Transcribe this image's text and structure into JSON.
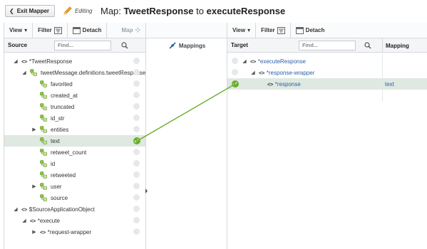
{
  "topbar": {
    "exit_label": "Exit Mapper",
    "editing_label": "Editing",
    "map_prefix": "Map:",
    "map_source": "TweetResponse",
    "map_to": "to",
    "map_target": "executeResponse"
  },
  "left": {
    "toolbar": {
      "view": "View",
      "filter": "Filter",
      "detach": "Detach",
      "map": "Map"
    },
    "header": "Source",
    "search_placeholder": "Find...",
    "tree": [
      {
        "label": "*TweetResponse",
        "type": "element",
        "expanded": true,
        "depth": 0,
        "blue": false
      },
      {
        "label": "tweetMessage.definitions.tweetResponse",
        "type": "leaf",
        "expanded": true,
        "depth": 1,
        "blue": false
      },
      {
        "label": "favorited",
        "type": "leaf",
        "depth": 2
      },
      {
        "label": "created_at",
        "type": "leaf",
        "depth": 2
      },
      {
        "label": "truncated",
        "type": "leaf",
        "depth": 2
      },
      {
        "label": "id_str",
        "type": "leaf",
        "depth": 2
      },
      {
        "label": "entities",
        "type": "leaf",
        "collapsed": true,
        "depth": 2
      },
      {
        "label": "text",
        "type": "leaf",
        "depth": 2,
        "selected": true,
        "mapped": true
      },
      {
        "label": "retweet_count",
        "type": "leaf",
        "depth": 2
      },
      {
        "label": "id",
        "type": "leaf",
        "depth": 2
      },
      {
        "label": "retweeted",
        "type": "leaf",
        "depth": 2
      },
      {
        "label": "user",
        "type": "leaf",
        "collapsed": true,
        "depth": 2
      },
      {
        "label": "source",
        "type": "leaf",
        "depth": 2
      },
      {
        "label": "$SourceApplicationObject",
        "type": "element",
        "expanded": true,
        "depth": 0
      },
      {
        "label": "*execute",
        "type": "element",
        "expanded": true,
        "depth": 1
      },
      {
        "label": "*request-wrapper",
        "type": "element",
        "collapsed": true,
        "depth": 2
      }
    ]
  },
  "middle": {
    "mappings_label": "Mappings"
  },
  "right": {
    "toolbar": {
      "view": "View",
      "filter": "Filter",
      "detach": "Detach"
    },
    "header_target": "Target",
    "header_mapping": "Mapping",
    "search_placeholder": "Find...",
    "tree": [
      {
        "label": "*executeResponse",
        "depth": 0,
        "expanded": true,
        "mapping": ""
      },
      {
        "label": "*response-wrapper",
        "depth": 1,
        "expanded": true,
        "mapping": ""
      },
      {
        "label": "*response",
        "depth": 2,
        "selected": true,
        "mapped": true,
        "mapping": "text"
      }
    ]
  },
  "colors": {
    "accent_green": "#6aae2b",
    "selected_row": "#dfe8e1",
    "link_blue": "#2a5fa8"
  }
}
